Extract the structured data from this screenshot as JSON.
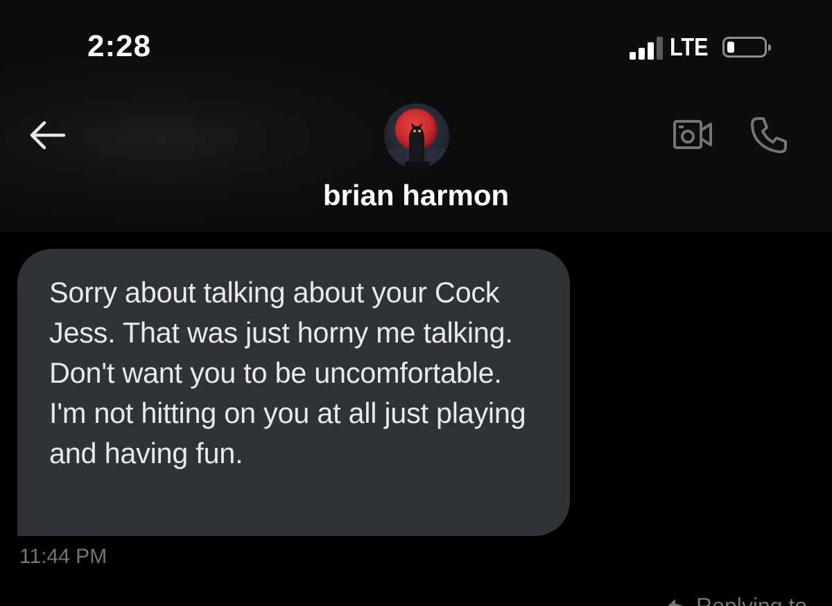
{
  "status_bar": {
    "time": "2:28",
    "network": "LTE",
    "signal_bars_active": 3,
    "signal_bars_total": 4,
    "battery_level": 0.2
  },
  "header": {
    "contact_name": "brian harmon",
    "avatar_icon": "owl-blood-moon-avatar",
    "back_icon": "arrow-left-icon",
    "video_icon": "video-camera-icon",
    "call_icon": "phone-icon"
  },
  "messages": [
    {
      "direction": "incoming",
      "text": "Sorry about talking about your Cock Jess. That was just horny me talking. Don't want you to be uncomfortable. I'm not hitting on you at all just playing and having fun.",
      "time": "11:44 PM"
    }
  ],
  "footer": {
    "replying_label": "Replying to"
  },
  "colors": {
    "background": "#000000",
    "header_background": "#111113",
    "bubble_incoming": "#2f3336",
    "text_primary": "#e7e9ea",
    "text_secondary": "#71767b",
    "avatar_moon": "#c9272d"
  }
}
